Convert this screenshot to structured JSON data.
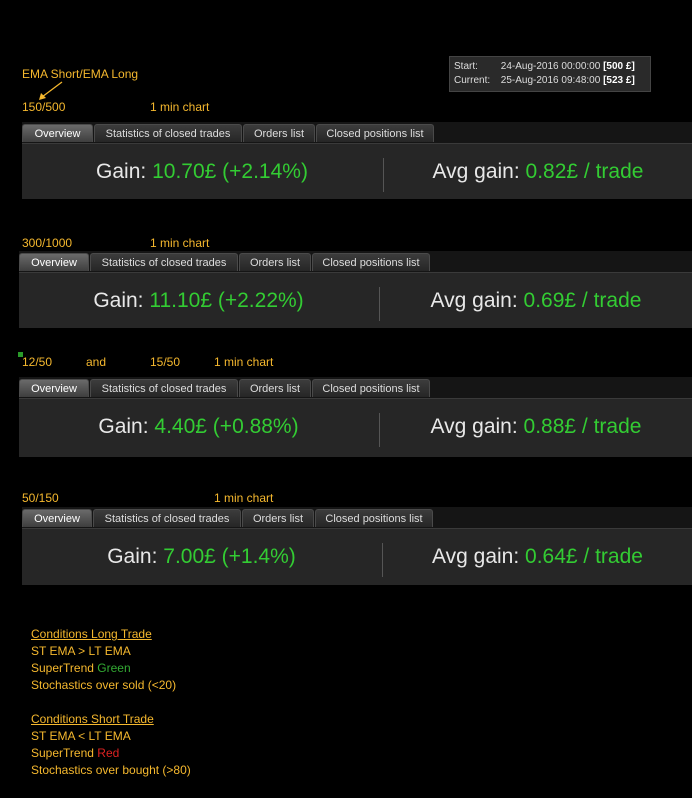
{
  "annotation": {
    "label": "EMA Short/EMA Long"
  },
  "datebox": {
    "start_label": "Start:",
    "start_value": "24-Aug-2016 00:00:00",
    "start_amount": "[500 £]",
    "current_label": "Current:",
    "current_value": "25-Aug-2016 09:48:00",
    "current_amount": "[523 £]"
  },
  "tabs": [
    "Overview",
    "Statistics of closed trades",
    "Orders list",
    "Closed positions list"
  ],
  "gain_label": "Gain:",
  "avg_label": "Avg gain:",
  "panels": [
    {
      "ema": "150/500",
      "chart": "1 min chart",
      "gain": "10.70£ (+2.14%)",
      "avg": "0.82£ / trade"
    },
    {
      "ema": "300/1000",
      "chart": "1 min chart",
      "gain": "11.10£ (+2.22%)",
      "avg": "0.69£ / trade"
    },
    {
      "ema": "12/50",
      "ema_and": "and",
      "ema2": "15/50",
      "chart": "1 min chart",
      "gain": "4.40£ (+0.88%)",
      "avg": "0.88£ / trade"
    },
    {
      "ema": "50/150",
      "chart": "1 min chart",
      "gain": "7.00£ (+1.4%)",
      "avg": "0.64£ / trade"
    }
  ],
  "conditions_long": {
    "title": "Conditions Long Trade",
    "line1": "ST EMA > LT EMA",
    "line2_prefix": "SuperTrend",
    "line2_color_word": "Green",
    "line3": "Stochastics over sold (<20)"
  },
  "conditions_short": {
    "title": "Conditions Short Trade",
    "line1": "ST EMA < LT EMA",
    "line2_prefix": "SuperTrend",
    "line2_color_word": "Red",
    "line3": "Stochastics over bought (>80)"
  }
}
